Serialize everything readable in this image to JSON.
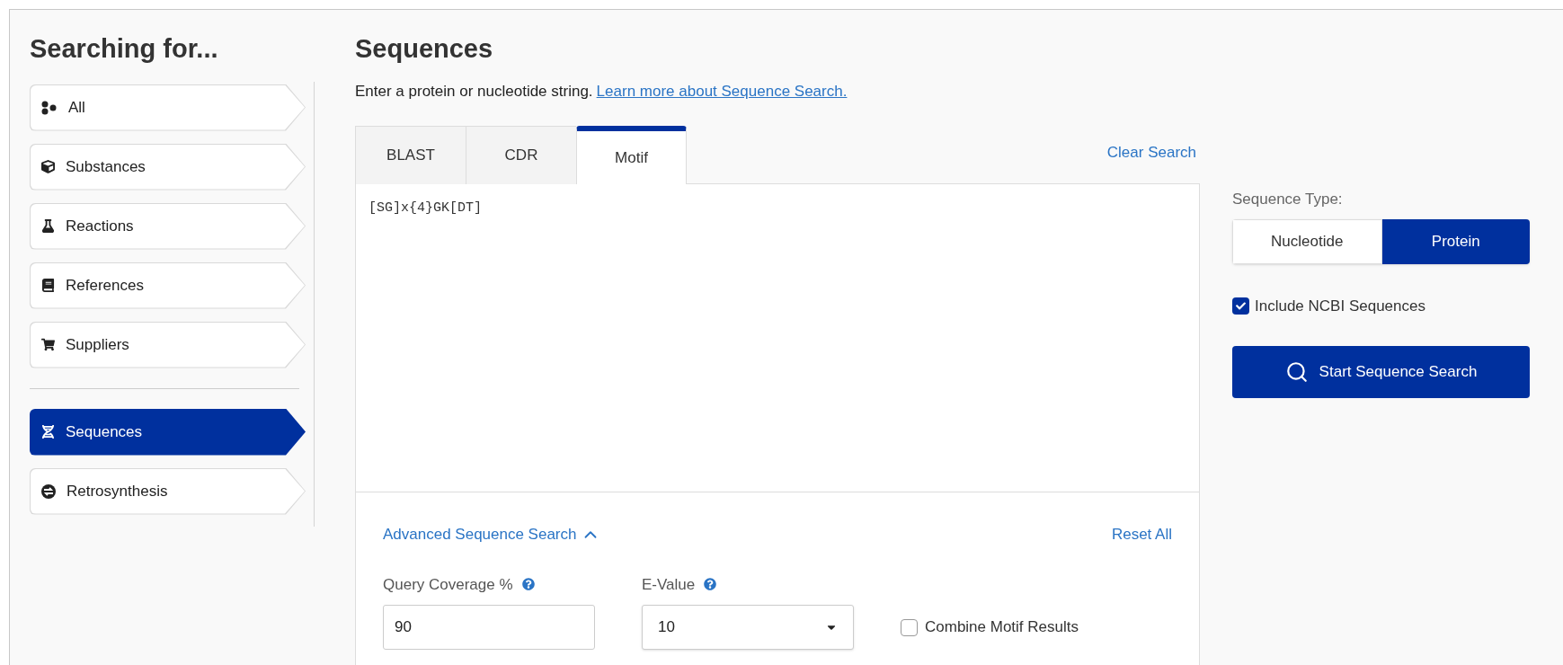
{
  "sidebar": {
    "title": "Searching for...",
    "groups": [
      [
        {
          "label": "All",
          "selected": false
        },
        {
          "label": "Substances",
          "selected": false
        },
        {
          "label": "Reactions",
          "selected": false
        },
        {
          "label": "References",
          "selected": false
        },
        {
          "label": "Suppliers",
          "selected": false
        }
      ],
      [
        {
          "label": "Sequences",
          "selected": true
        },
        {
          "label": "Retrosynthesis",
          "selected": false
        }
      ]
    ]
  },
  "main": {
    "title": "Sequences",
    "description": {
      "text": "Enter a protein or nucleotide string.",
      "link": "Learn more about Sequence Search."
    },
    "tabs": [
      {
        "label": "BLAST",
        "selected": false
      },
      {
        "label": "CDR",
        "selected": false
      },
      {
        "label": "Motif",
        "selected": true
      }
    ],
    "clear_search": "Clear Search",
    "query": {
      "value": "[SG]x{4}GK[DT]"
    },
    "advanced": {
      "label": "Advanced Sequence Search",
      "expanded": true,
      "reset": "Reset All",
      "query_coverage": {
        "label": "Query Coverage %",
        "value": "90"
      },
      "e_value": {
        "label": "E-Value",
        "value": "10"
      },
      "combine": {
        "label": "Combine Motif Results",
        "checked": false
      }
    }
  },
  "options": {
    "sequence_type": {
      "label": "Sequence Type:",
      "choices": [
        {
          "label": "Nucleotide",
          "selected": false
        },
        {
          "label": "Protein",
          "selected": true
        }
      ]
    },
    "include_ncbi": {
      "label": "Include NCBI Sequences",
      "checked": true
    },
    "start_button": "Start Sequence Search"
  }
}
